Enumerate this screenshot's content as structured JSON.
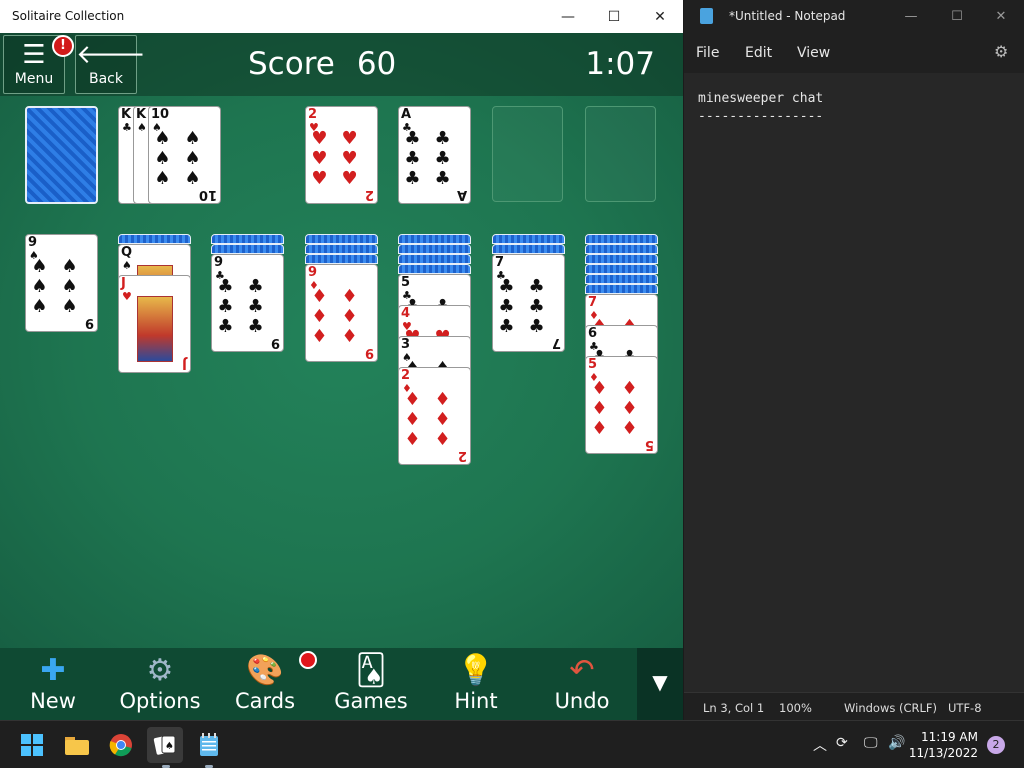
{
  "solitaire": {
    "title": "Solitaire Collection",
    "menu_label": "Menu",
    "menu_badge": "!",
    "back_label": "Back",
    "score_label": "Score",
    "score_value": "60",
    "timer": "1:07",
    "toolbar": [
      "New",
      "Options",
      "Cards",
      "Games",
      "Hint",
      "Undo"
    ],
    "waste": [
      {
        "rank": "K",
        "suit": "♣",
        "color": "black"
      },
      {
        "rank": "K",
        "suit": "♠",
        "color": "black"
      },
      {
        "rank": "10",
        "suit": "♠",
        "color": "black"
      }
    ],
    "foundations": [
      {
        "rank": "2",
        "suit": "♥",
        "color": "red"
      },
      {
        "rank": "A",
        "suit": "♣",
        "color": "black"
      }
    ],
    "tableau": [
      {
        "hidden": 0,
        "cards": [
          {
            "rank": "9",
            "suit": "♠",
            "color": "black"
          }
        ]
      },
      {
        "hidden": 1,
        "cards": [
          {
            "rank": "Q",
            "suit": "♠",
            "color": "black"
          },
          {
            "rank": "J",
            "suit": "♥",
            "color": "red"
          }
        ]
      },
      {
        "hidden": 2,
        "cards": [
          {
            "rank": "9",
            "suit": "♣",
            "color": "black"
          }
        ]
      },
      {
        "hidden": 3,
        "cards": [
          {
            "rank": "9",
            "suit": "♦",
            "color": "red"
          }
        ]
      },
      {
        "hidden": 4,
        "cards": [
          {
            "rank": "5",
            "suit": "♣",
            "color": "black"
          },
          {
            "rank": "4",
            "suit": "♥",
            "color": "red"
          },
          {
            "rank": "3",
            "suit": "♠",
            "color": "black"
          },
          {
            "rank": "2",
            "suit": "♦",
            "color": "red"
          }
        ]
      },
      {
        "hidden": 2,
        "cards": [
          {
            "rank": "7",
            "suit": "♣",
            "color": "black"
          }
        ]
      },
      {
        "hidden": 6,
        "cards": [
          {
            "rank": "7",
            "suit": "♦",
            "color": "red"
          },
          {
            "rank": "6",
            "suit": "♣",
            "color": "black"
          },
          {
            "rank": "5",
            "suit": "♦",
            "color": "red"
          }
        ]
      }
    ]
  },
  "notepad": {
    "title": "*Untitled - Notepad",
    "menu": [
      "File",
      "Edit",
      "View"
    ],
    "content": "minesweeper chat\n----------------",
    "status": {
      "position": "Ln 3, Col 1",
      "zoom": "100%",
      "line_ending": "Windows (CRLF)",
      "encoding": "UTF-8"
    }
  },
  "taskbar": {
    "time": "11:19 AM",
    "date": "11/13/2022",
    "notifications": "2"
  }
}
